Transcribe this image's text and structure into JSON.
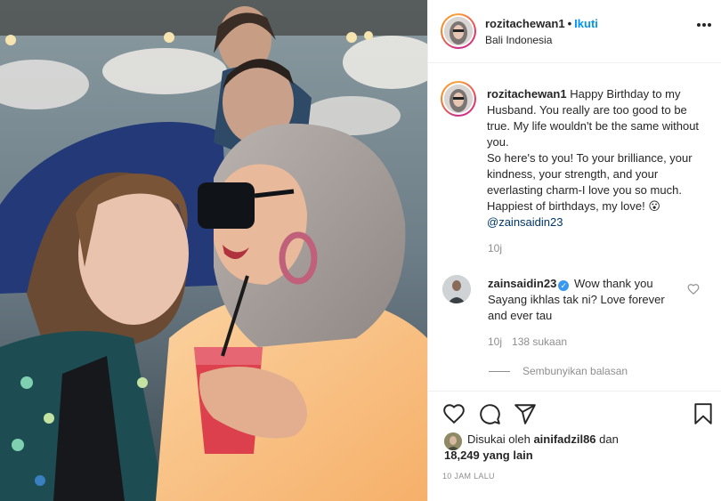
{
  "post": {
    "username": "rozitachewan1",
    "separator": "•",
    "follow_label": "Ikuti",
    "location": "Bali Indonesia",
    "more_icon": "more-options-icon"
  },
  "caption": {
    "username": "rozitachewan1",
    "text": "Happy Birthday to my Husband. You really are too good to be true. My life wouldn't be the same without you.",
    "text2": "So here's to you! To your brilliance, your kindness, your strength, and your everlasting charm-I love you so much. Happiest of birthdays, my love! 😮",
    "mention": "@zainsaidin23",
    "time": "10j"
  },
  "reply": {
    "username": "zainsaidin23",
    "verified": true,
    "text": "Wow thank you Sayang ikhlas tak ni? Love forever and ever tau",
    "time": "10j",
    "likes": "138 sukaan",
    "hide_replies": "Sembunyikan balasan"
  },
  "actions": {
    "like_icon": "heart-icon",
    "comment_icon": "comment-icon",
    "share_icon": "share-icon",
    "save_icon": "bookmark-icon"
  },
  "likes": {
    "prefix": "Disukai oleh",
    "user": "ainifadzil86",
    "conj": "dan",
    "count": "18,249 yang lain"
  },
  "timestamp": "10 JAM LALU",
  "colors": {
    "link_blue": "#0095f6",
    "mention_blue": "#00376b",
    "text": "#262626",
    "muted": "#8e8e8e",
    "verified": "#3897f0"
  }
}
